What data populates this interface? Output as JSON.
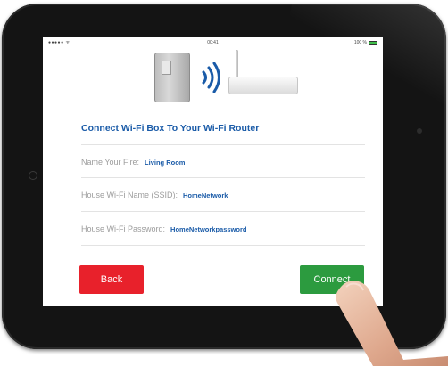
{
  "status_bar": {
    "carrier": "●●●●● ᯤ",
    "time": "00:41",
    "battery": "100 %"
  },
  "screen": {
    "title": "Connect Wi-Fi Box To Your Wi-Fi Router",
    "fields": [
      {
        "label": "Name Your Fire:",
        "value": "Living Room"
      },
      {
        "label": "House Wi-Fi Name (SSID):",
        "value": "HomeNetwork"
      },
      {
        "label": "House Wi-Fi Password:",
        "value": "HomeNetworkpassword"
      }
    ],
    "back_label": "Back",
    "connect_label": "Connect"
  },
  "colors": {
    "title": "#1a5ba8",
    "back_button": "#e8212b",
    "connect_button": "#2c9b3f"
  },
  "icons": [
    "wifi-box-device-icon",
    "wifi-signal-icon",
    "router-icon",
    "battery-icon"
  ]
}
